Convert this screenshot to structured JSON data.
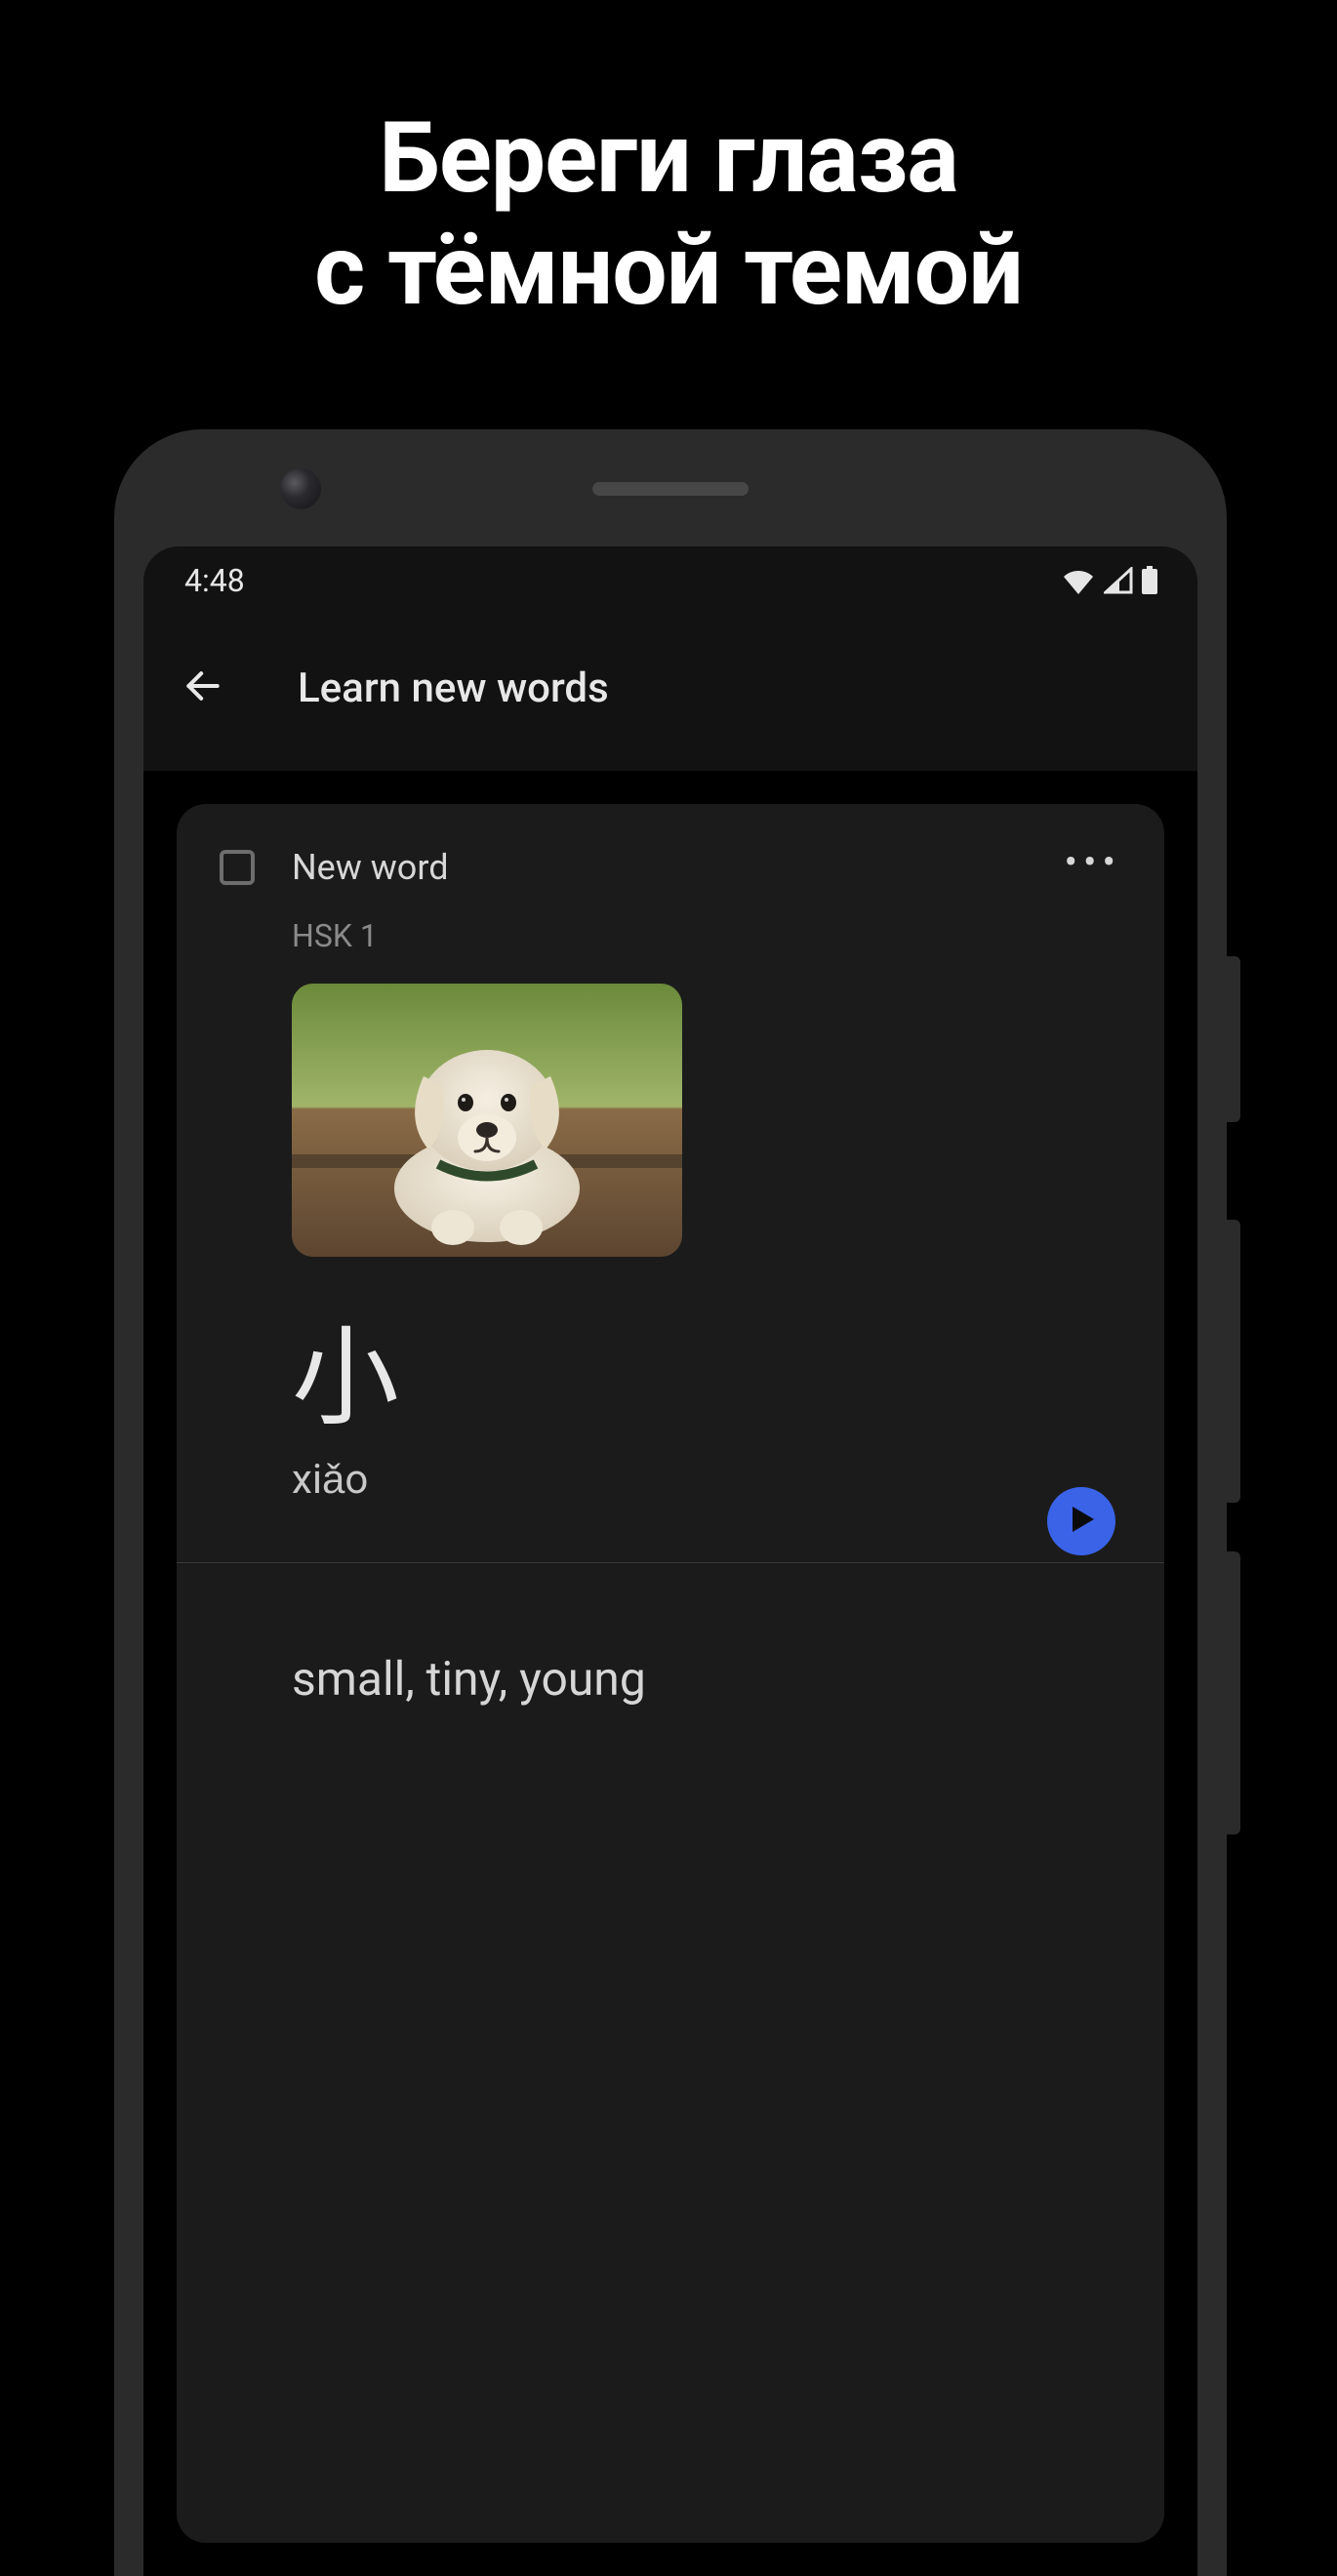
{
  "promo": {
    "line1": "Береги глаза",
    "line2": "с тёмной темой"
  },
  "status": {
    "time": "4:48"
  },
  "appbar": {
    "title": "Learn new words"
  },
  "card": {
    "new_word_label": "New word",
    "level": "HSK 1",
    "hanzi": "小",
    "pinyin": "xiǎo",
    "translation": "small, tiny, young",
    "image_alt": "puppy"
  }
}
